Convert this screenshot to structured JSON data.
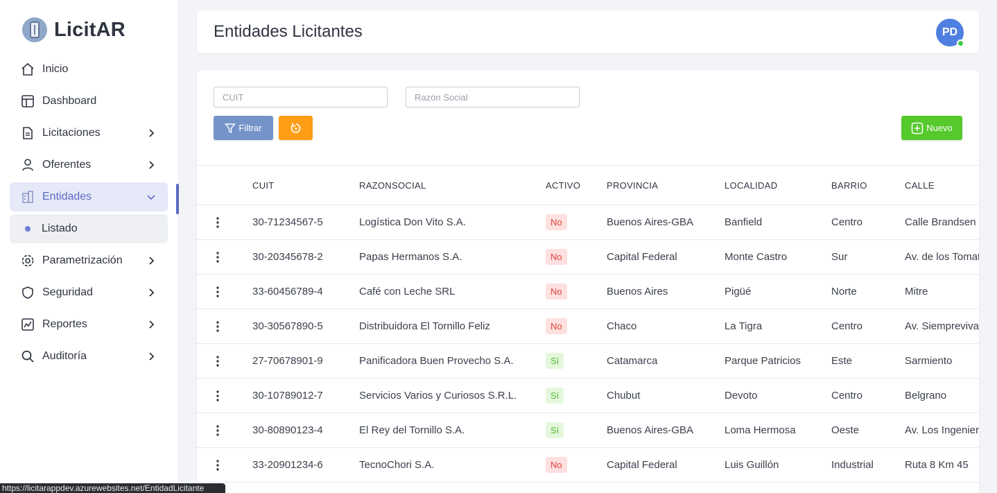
{
  "app": {
    "name": "LicitAR"
  },
  "sidebar": {
    "items": [
      {
        "label": "Inicio",
        "icon": "home-icon"
      },
      {
        "label": "Dashboard",
        "icon": "dashboard-icon"
      },
      {
        "label": "Licitaciones",
        "icon": "document-icon"
      },
      {
        "label": "Oferentes",
        "icon": "user-icon"
      },
      {
        "label": "Entidades",
        "icon": "building-icon"
      },
      {
        "label": "Listado",
        "icon": "dot-icon"
      },
      {
        "label": "Parametrización",
        "icon": "gear-icon"
      },
      {
        "label": "Seguridad",
        "icon": "shield-icon"
      },
      {
        "label": "Reportes",
        "icon": "chart-icon"
      },
      {
        "label": "Auditoría",
        "icon": "search-icon"
      }
    ]
  },
  "header": {
    "title": "Entidades Licitantes",
    "avatar_initials": "PD"
  },
  "filters": {
    "cuit_placeholder": "CUIT",
    "razon_placeholder": "Razón Social",
    "filter_label": "Filtrar",
    "new_label": "Nuevo"
  },
  "table": {
    "columns": [
      "CUIT",
      "RAZONSOCIAL",
      "ACTIVO",
      "PROVINCIA",
      "LOCALIDAD",
      "BARRIO",
      "CALLE"
    ],
    "rows": [
      [
        "30-71234567-5",
        "Logística Don Vito S.A.",
        "No",
        "Buenos Aires-GBA",
        "Banfield",
        "Centro",
        "Calle Brandsen"
      ],
      [
        "30-20345678-2",
        "Papas Hermanos S.A.",
        "No",
        "Capital Federal",
        "Monte Castro",
        "Sur",
        "Av. de los Tomates"
      ],
      [
        "33-60456789-4",
        "Café con Leche SRL",
        "No",
        "Buenos Aires",
        "Pigüé",
        "Norte",
        "Mitre"
      ],
      [
        "30-30567890-5",
        "Distribuidora El Tornillo Feliz",
        "No",
        "Chaco",
        "La Tigra",
        "Centro",
        "Av. Siempreviva"
      ],
      [
        "27-70678901-9",
        "Panificadora Buen Provecho S.A.",
        "Sí",
        "Catamarca",
        "Parque Patricios",
        "Este",
        "Sarmiento"
      ],
      [
        "30-10789012-7",
        "Servicios Varios y Curiosos S.R.L.",
        "Sí",
        "Chubut",
        "Devoto",
        "Centro",
        "Belgrano"
      ],
      [
        "30-80890123-4",
        "El Rey del Tornillo S.A.",
        "Sí",
        "Buenos Aires-GBA",
        "Loma Hermosa",
        "Oeste",
        "Av. Los Ingenieros"
      ],
      [
        "33-20901234-6",
        "TecnoChori S.A.",
        "No",
        "Capital Federal",
        "Luis Guillón",
        "Industrial",
        "Ruta 8 Km 45"
      ]
    ]
  },
  "status_bar": {
    "url": "https://licitarappdev.azurewebsites.net/EntidadLicitante"
  },
  "colors": {
    "accent": "#5b6ac4",
    "filter": "#7493c9",
    "reset": "#ff9d14",
    "new": "#56c92d"
  }
}
